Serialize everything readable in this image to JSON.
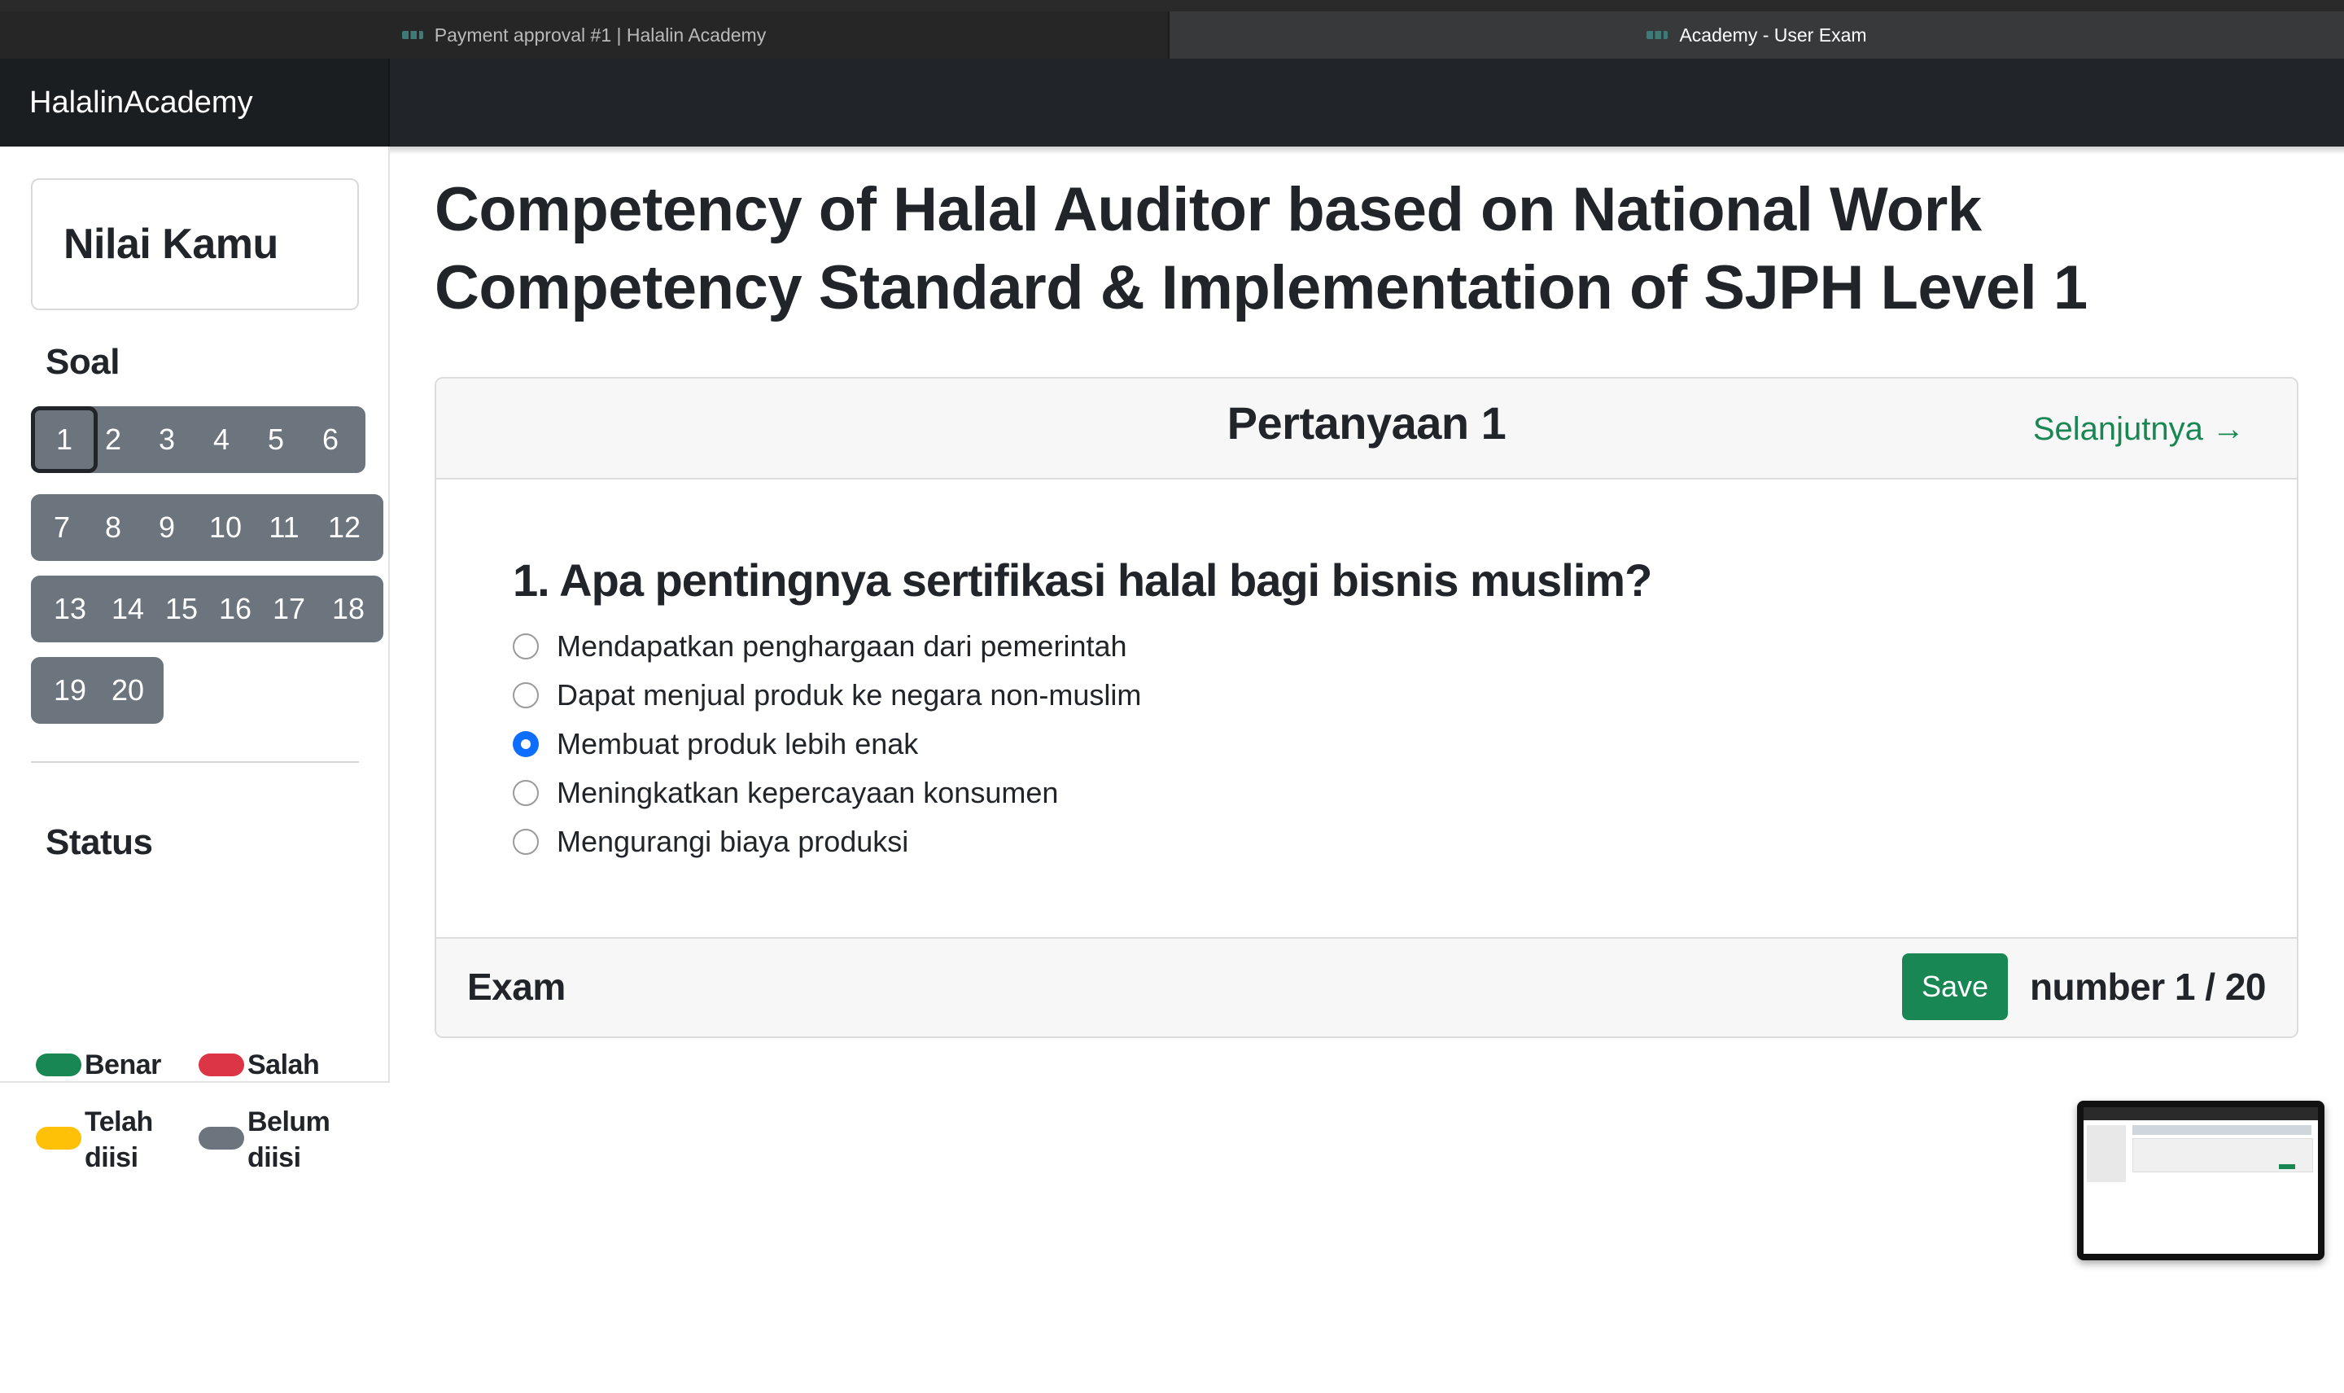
{
  "browser": {
    "tabs": [
      {
        "label": "Payment approval #1 | Halalin Academy",
        "active": false
      },
      {
        "label": "Academy - User Exam",
        "active": true
      }
    ]
  },
  "navbar": {
    "brand": "HalalinAcademy"
  },
  "sidebar": {
    "score_label": "Nilai Kamu",
    "questions_title": "Soal",
    "question_numbers": [
      "1",
      "2",
      "3",
      "4",
      "5",
      "6",
      "7",
      "8",
      "9",
      "10",
      "11",
      "12",
      "13",
      "14",
      "15",
      "16",
      "17",
      "18",
      "19",
      "20"
    ],
    "current_question": "1",
    "status_title": "Status",
    "legend": [
      {
        "label": "Benar",
        "color": "#198754"
      },
      {
        "label": "Salah",
        "color": "#dc3545"
      },
      {
        "label": "Telah diisi",
        "color": "#ffc107"
      },
      {
        "label": "Belum diisi",
        "color": "#6c757d"
      }
    ]
  },
  "main": {
    "title": "Competency of Halal Auditor based on National Work Competency Standard & Implementation of SJPH Level 1",
    "card": {
      "header_title": "Pertanyaan 1",
      "next_label": "Selanjutnya →",
      "question": "1. Apa pentingnya sertifikasi halal bagi bisnis muslim?",
      "options": [
        {
          "label": "Mendapatkan penghargaan dari pemerintah",
          "checked": false
        },
        {
          "label": "Dapat menjual produk ke negara non-muslim",
          "checked": false
        },
        {
          "label": "Membuat produk lebih enak",
          "checked": true
        },
        {
          "label": "Meningkatkan kepercayaan konsumen",
          "checked": false
        },
        {
          "label": "Mengurangi biaya produksi",
          "checked": false
        }
      ],
      "footer_label": "Exam",
      "save_label": "Save",
      "counter": "number 1 / 20"
    }
  },
  "colors": {
    "accent": "#198754",
    "radio_selected": "#0d6efd",
    "navbar": "#212529",
    "question_button": "#6c757d"
  }
}
